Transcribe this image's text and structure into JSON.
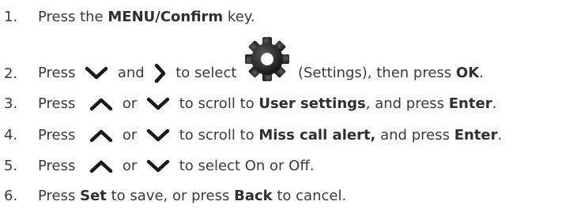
{
  "steps": [
    {
      "number": "1.",
      "parts": [
        "Press the ",
        "MENU/Confirm",
        " key."
      ]
    },
    {
      "number": "2.",
      "parts": [
        "Press",
        "and",
        "to select",
        "(Settings), then press ",
        "OK",
        "."
      ],
      "icons": [
        "chevron-down-icon",
        "chevron-right-icon",
        "settings-gear-icon"
      ]
    },
    {
      "number": "3.",
      "parts": [
        "Press",
        "or",
        "to scroll to ",
        "User settings",
        ", and press ",
        "Enter",
        "."
      ],
      "icons": [
        "chevron-up-icon",
        "chevron-down-icon"
      ]
    },
    {
      "number": "4.",
      "parts": [
        "Press",
        "or",
        "to scroll to ",
        "Miss call alert,",
        " and press ",
        "Enter",
        "."
      ],
      "icons": [
        "chevron-up-icon",
        "chevron-down-icon"
      ]
    },
    {
      "number": "5.",
      "parts": [
        "Press",
        "or",
        "to  select On or Off."
      ],
      "icons": [
        "chevron-up-icon",
        "chevron-down-icon"
      ]
    },
    {
      "number": "6.",
      "parts": [
        "Press ",
        "Set",
        " to save, or press ",
        "Back",
        " to cancel."
      ]
    }
  ],
  "colors": {
    "text": "#3a3a3a",
    "icon": "#1a1a1a",
    "gear": "#222222"
  }
}
